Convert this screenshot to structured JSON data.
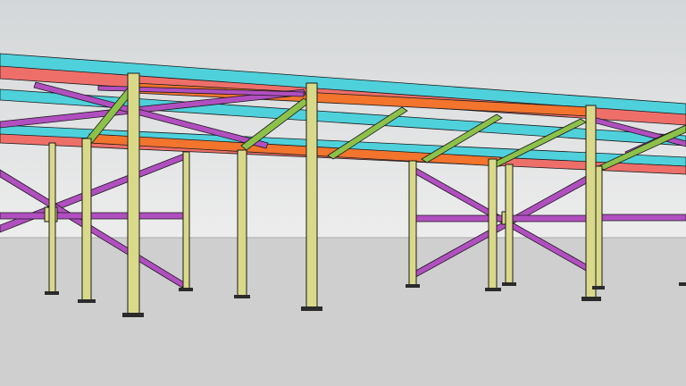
{
  "scene": {
    "subject": "steel-frame-structure-3d-model",
    "colors": {
      "sky_top": "#d3d6d8",
      "sky_bottom": "#ededed",
      "ground": "#cfcfcf",
      "horizon_line": "#a9a9a9",
      "column": "#d9d98a",
      "column_shade": "#b9b96a",
      "bracing": "#b14fc0",
      "bracing_light": "#d37ad8",
      "joist": "#8cc14a",
      "purlin": "#4fd1dc",
      "rafter": "#ee6f6a",
      "beam_orange": "#f2742d",
      "outline": "#1a1a1a",
      "base_plate": "#2b2b2b"
    },
    "member_types": [
      "column",
      "x-bracing",
      "roof-joist",
      "purlin",
      "rafter",
      "beam",
      "base-plate"
    ]
  }
}
